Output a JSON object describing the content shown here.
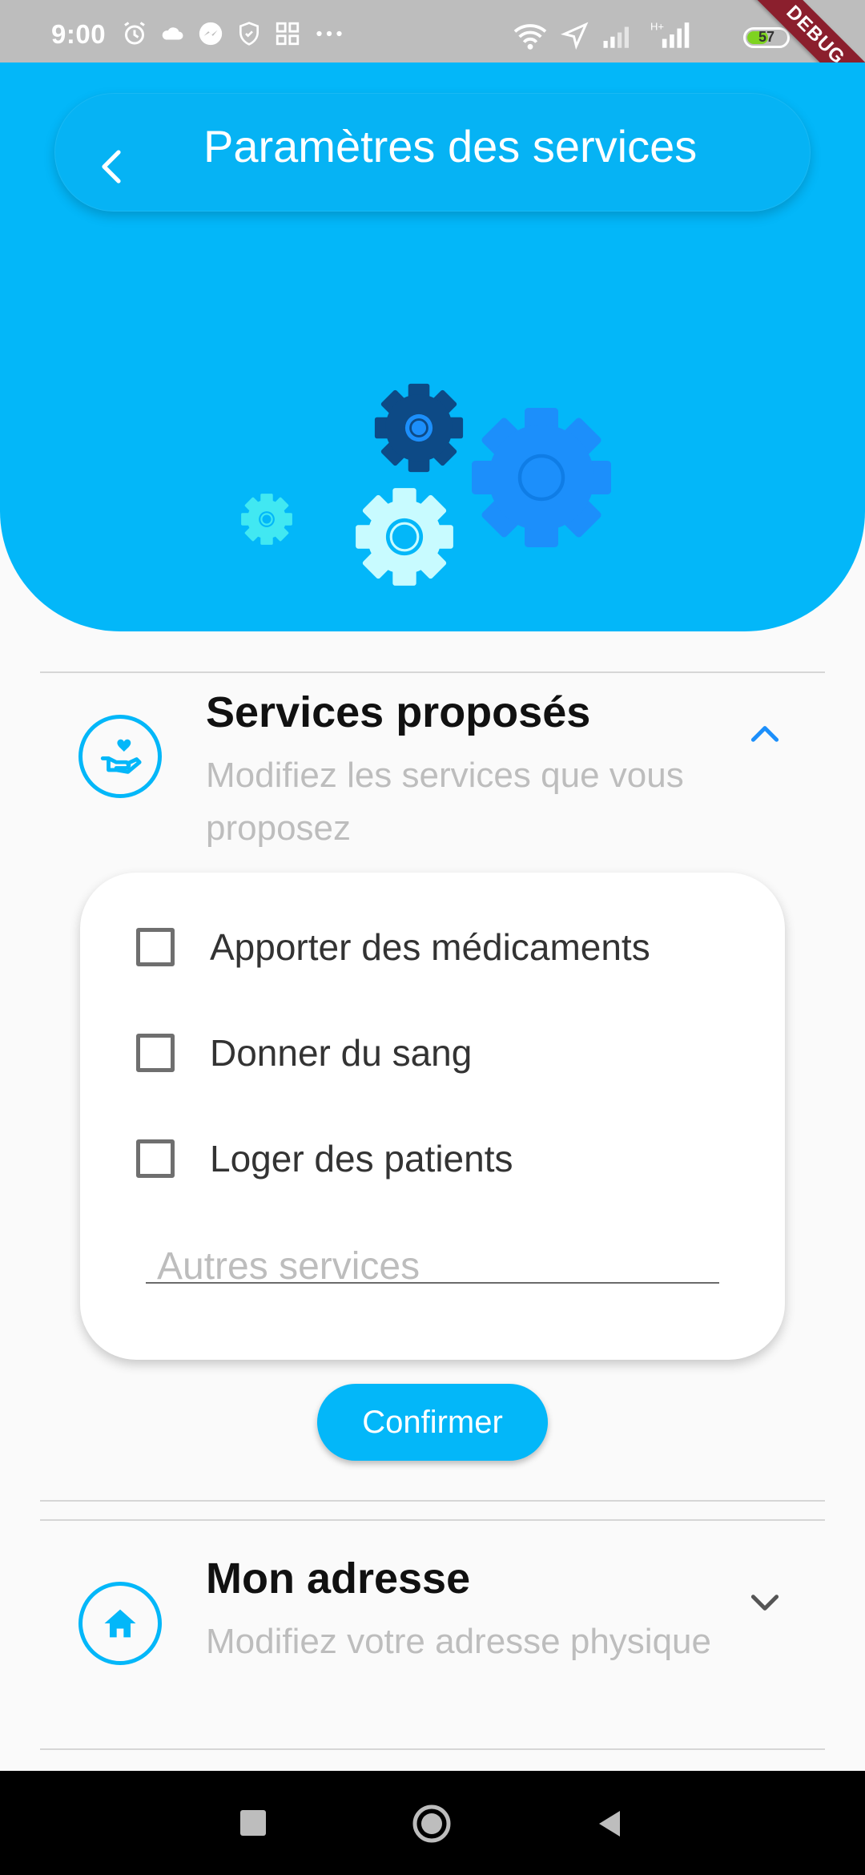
{
  "status_bar": {
    "time": "9:00",
    "battery": "57",
    "battery_level": 0.57,
    "debug_label": "DEBUG"
  },
  "header": {
    "title": "Paramètres des services",
    "back_icon": "chevron-left-icon",
    "illustration": "gears-illustration"
  },
  "sections": [
    {
      "title": "Services proposés",
      "subtitle": "Modifiez les services que vous proposez",
      "icon": "hand-heart-icon",
      "expanded": true,
      "options": [
        {
          "label": "Apporter des médicaments",
          "checked": false
        },
        {
          "label": "Donner du sang",
          "checked": false
        },
        {
          "label": "Loger des patients",
          "checked": false
        }
      ],
      "other_placeholder": "Autres services",
      "confirm_label": "Confirmer"
    },
    {
      "title": "Mon adresse",
      "subtitle": "Modifiez votre adresse physique",
      "icon": "home-icon",
      "expanded": false
    }
  ],
  "colors": {
    "primary": "#03b7f9",
    "gear_dark": "#0d4a86",
    "gear_blue": "#1c8ffb",
    "gear_light": "#c8fbff",
    "gear_cyan": "#41e8f2",
    "subtitle_gray": "#bdbdbd"
  }
}
